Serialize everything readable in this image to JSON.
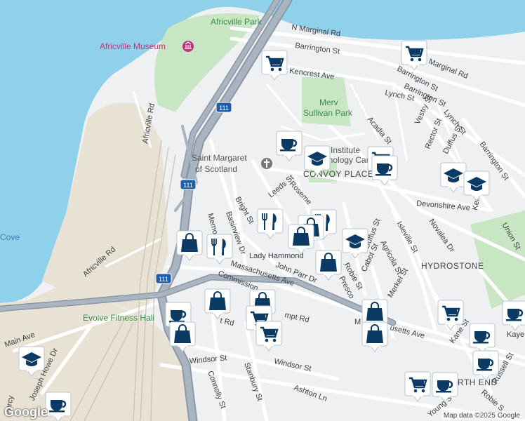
{
  "map": {
    "colors": {
      "water": "#8fd0ea",
      "land": "#eef0f2",
      "park": "#c8e6c4",
      "industrial": "#e7e2d4",
      "road": "#ffffff",
      "highway": "#9aa5b1",
      "marker": "#0b3a64"
    },
    "street_labels": [
      {
        "id": "n-marginal-rd",
        "text": "N Marginal Rd"
      },
      {
        "id": "barrington-st-1",
        "text": "Barrington St"
      },
      {
        "id": "marginal-rd",
        "text": "Marginal Rd"
      },
      {
        "id": "kencrest-ave",
        "text": "Kencrest Ave"
      },
      {
        "id": "barrington-st-2",
        "text": "Barrington St"
      },
      {
        "id": "barrington-st-3",
        "text": "Barrington St"
      },
      {
        "id": "lynch-st-1",
        "text": "Lynch St"
      },
      {
        "id": "acadia-st",
        "text": "Acadia St"
      },
      {
        "id": "vestry-st",
        "text": "Vestry St"
      },
      {
        "id": "lynch-st-2",
        "text": "Lynch St"
      },
      {
        "id": "rector-st",
        "text": "Rector St"
      },
      {
        "id": "duffus-st-1",
        "text": "Duffus St"
      },
      {
        "id": "barrington-st-4",
        "text": "Barrington St"
      },
      {
        "id": "africville-rd-1",
        "text": "Africville Rd"
      },
      {
        "id": "leeds-st",
        "text": "Leeds St"
      },
      {
        "id": "rosemeade",
        "text": "Roseme"
      },
      {
        "id": "bright-st",
        "text": "Bright St"
      },
      {
        "id": "basinview-dr",
        "text": "Basinview Dr"
      },
      {
        "id": "memorial",
        "text": "Memo"
      },
      {
        "id": "devonshire-ave",
        "text": "Devonshire Ave"
      },
      {
        "id": "novalea-dr",
        "text": "Novalea Dr"
      },
      {
        "id": "kenny-st",
        "text": "Kenny St"
      },
      {
        "id": "union-st",
        "text": "Union St"
      },
      {
        "id": "duffus-st-2",
        "text": "Duffus St"
      },
      {
        "id": "isleville-st",
        "text": "Isleville St"
      },
      {
        "id": "agricola-st",
        "text": "Agricola St"
      },
      {
        "id": "lady-hammond",
        "text": "Lady Hammond"
      },
      {
        "id": "massachusetts-ave-1",
        "text": "Massachusetts Ave"
      },
      {
        "id": "john-parr-dr",
        "text": "John Parr Dr"
      },
      {
        "id": "robie-st-1",
        "text": "Robie St"
      },
      {
        "id": "prescott",
        "text": "Presco"
      },
      {
        "id": "cabot-st",
        "text": "Cabot St"
      },
      {
        "id": "merkel-st",
        "text": "Merkel St"
      },
      {
        "id": "africville-rd-2",
        "text": "Africville Rd"
      },
      {
        "id": "commission",
        "text": "Commission"
      },
      {
        "id": "kempt-rd",
        "text": "mpt Rd"
      },
      {
        "id": "kempt-rd-2",
        "text": "t Rd"
      },
      {
        "id": "massachusetts-ave-2",
        "text": "M"
      },
      {
        "id": "massachusetts-ave-3",
        "text": "usetts Ave"
      },
      {
        "id": "main-ave",
        "text": "Main Ave"
      },
      {
        "id": "joseph-howe-dr",
        "text": "Joseph Howe Dr"
      },
      {
        "id": "windsor-st-1",
        "text": "Windsor St"
      },
      {
        "id": "windsor-st-2",
        "text": "Windsor St"
      },
      {
        "id": "stanbury-st",
        "text": "Stanbury St"
      },
      {
        "id": "connolly-st",
        "text": "Connolly St"
      },
      {
        "id": "ashton-ln",
        "text": "Ashton Ln"
      },
      {
        "id": "kane-st",
        "text": "Kane St"
      },
      {
        "id": "kaye",
        "text": "Kaye"
      },
      {
        "id": "russell-st",
        "text": "Russell St"
      },
      {
        "id": "robie-st-2",
        "text": "Robie S"
      },
      {
        "id": "young-st",
        "text": "Young S"
      },
      {
        "id": "percy",
        "text": "Percy"
      }
    ],
    "highway_shields": [
      "111",
      "111",
      "111"
    ],
    "pois": {
      "africville_park": "Africville Park",
      "africville_museum": "Africville Museum",
      "merv_sullivan_park_1": "Merv",
      "merv_sullivan_park_2": "Sullivan Park",
      "saint_margaret_1": "Saint Margaret",
      "saint_margaret_2": "of Scotland",
      "evolve_fitness": "Evolve Fitness Hali",
      "institute_1": "Institute",
      "institute_2": "hnology Cam"
    },
    "areas": {
      "convoy_place": "CONVOY PLACE",
      "hydrostone": "HYDROSTONE",
      "north_end": "RTH END",
      "cove": "Cove"
    },
    "markers": [
      {
        "type": "grocery",
        "icon": "shopping-cart-icon"
      },
      {
        "type": "grocery",
        "icon": "shopping-cart-icon"
      },
      {
        "type": "cafe",
        "icon": "coffee-cup-icon"
      },
      {
        "type": "school",
        "icon": "graduation-cap-icon"
      },
      {
        "type": "grocery",
        "icon": "shopping-cart-icon"
      },
      {
        "type": "cafe",
        "icon": "coffee-cup-icon"
      },
      {
        "type": "school",
        "icon": "graduation-cap-icon"
      },
      {
        "type": "school",
        "icon": "graduation-cap-icon"
      },
      {
        "type": "restaurant",
        "icon": "fork-knife-icon"
      },
      {
        "type": "restaurant",
        "icon": "fork-knife-icon"
      },
      {
        "type": "store",
        "icon": "shopping-bag-icon"
      },
      {
        "type": "store",
        "icon": "shopping-bag-icon"
      },
      {
        "type": "school",
        "icon": "graduation-cap-icon"
      },
      {
        "type": "store",
        "icon": "shopping-bag-icon"
      },
      {
        "type": "restaurant",
        "icon": "fork-knife-icon"
      },
      {
        "type": "store",
        "icon": "shopping-bag-icon"
      },
      {
        "type": "store",
        "icon": "shopping-bag-icon"
      },
      {
        "type": "store",
        "icon": "shopping-bag-icon"
      },
      {
        "type": "grocery",
        "icon": "shopping-cart-icon"
      },
      {
        "type": "grocery",
        "icon": "shopping-cart-icon"
      },
      {
        "type": "cafe",
        "icon": "coffee-cup-icon"
      },
      {
        "type": "store",
        "icon": "shopping-bag-icon"
      },
      {
        "type": "store",
        "icon": "shopping-bag-icon"
      },
      {
        "type": "grocery",
        "icon": "shopping-cart-icon"
      },
      {
        "type": "cafe",
        "icon": "coffee-cup-icon"
      },
      {
        "type": "cafe",
        "icon": "coffee-cup-icon"
      },
      {
        "type": "cafe",
        "icon": "coffee-cup-icon"
      },
      {
        "type": "school",
        "icon": "graduation-cap-icon"
      },
      {
        "type": "grocery",
        "icon": "shopping-cart-icon"
      },
      {
        "type": "cafe",
        "icon": "coffee-cup-icon"
      },
      {
        "type": "cafe",
        "icon": "coffee-cup-icon"
      }
    ],
    "attribution": "Map data ©2025 Google",
    "logo": "Google"
  }
}
